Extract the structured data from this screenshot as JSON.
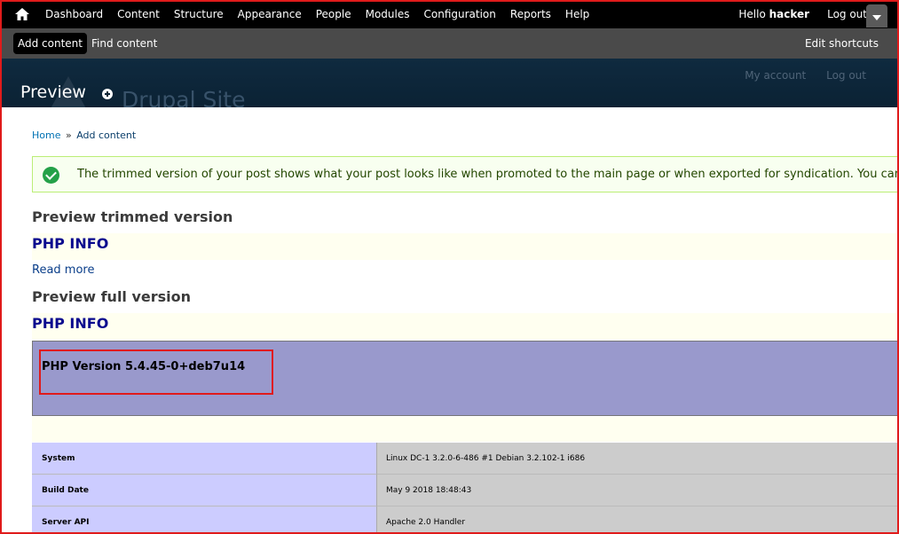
{
  "toolbar": {
    "menu": [
      "Dashboard",
      "Content",
      "Structure",
      "Appearance",
      "People",
      "Modules",
      "Configuration",
      "Reports",
      "Help"
    ],
    "hello": "Hello ",
    "username": "hacker",
    "logout": "Log out"
  },
  "shortcuts": {
    "add_content": "Add content",
    "find_content": "Find content",
    "edit_shortcuts": "Edit shortcuts"
  },
  "header": {
    "page_title": "Preview",
    "site_name": "Drupal Site",
    "my_account": "My account",
    "log_out": "Log out"
  },
  "breadcrumb": {
    "home": "Home",
    "separator": "»",
    "current": "Add content"
  },
  "status_message": "The trimmed version of your post shows what your post looks like when promoted to the main page or when exported for syndication. You can",
  "preview": {
    "trimmed_heading": "Preview trimmed version",
    "trimmed_title": "PHP INFO",
    "read_more": "Read more",
    "full_heading": "Preview full version",
    "full_title": "PHP INFO"
  },
  "phpinfo": {
    "version": "PHP Version 5.4.45-0+deb7u14",
    "rows": [
      {
        "key": "System",
        "value": "Linux DC-1 3.2.0-6-486 #1 Debian 3.2.102-1 i686"
      },
      {
        "key": "Build Date",
        "value": "May 9 2018 18:48:43"
      },
      {
        "key": "Server API",
        "value": "Apache 2.0 Handler"
      }
    ]
  },
  "colors": {
    "toolbar_bg": "#000000",
    "shortcuts_bg": "#4a4a4a",
    "header_bg": "#0b2234",
    "php_header_bg": "#9999cc",
    "php_key_bg": "#ccccff",
    "php_value_bg": "#cccccc",
    "highlight_border": "#e01b1b"
  }
}
